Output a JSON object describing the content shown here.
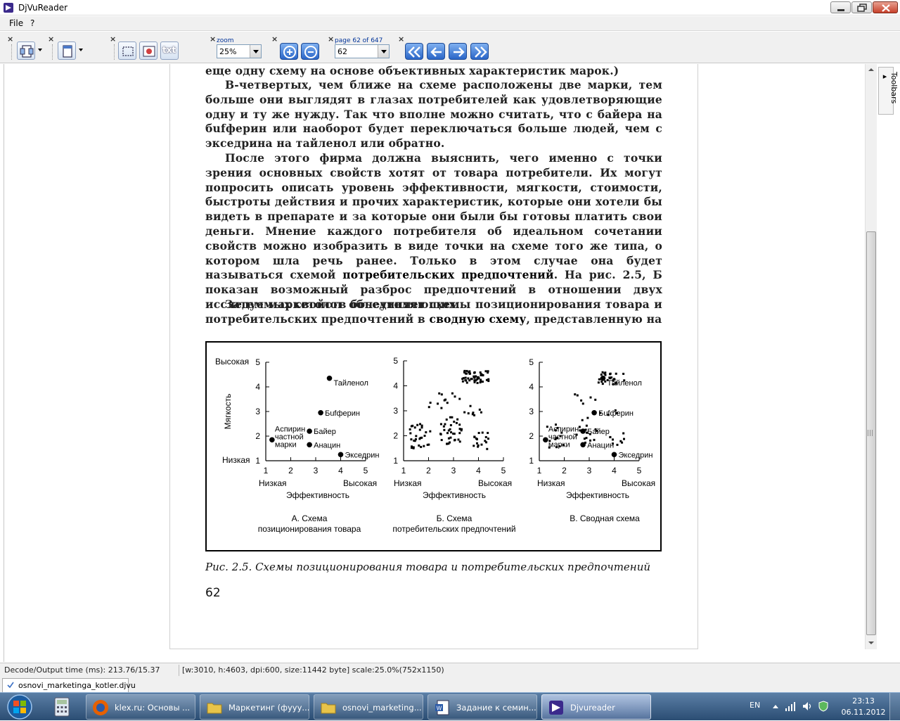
{
  "window": {
    "title": "DjVuReader"
  },
  "menu": [
    {
      "label": "File"
    },
    {
      "label": "?"
    }
  ],
  "toolbar": {
    "close_glyph": "×",
    "zoom_label": "zoom",
    "zoom_value": "25%",
    "page_label": "page 62 of 647",
    "page_value": "62",
    "text_button": "txt"
  },
  "toolbars_tab": "Toolbars ▸",
  "document": {
    "paragraphs": [
      {
        "text": "еще одну схему на основе объективных характеристик марок.)",
        "indent": false
      },
      {
        "text": "В-четвертых, чем ближе на схеме расположены две марки, тем больше они выглядят в глазах потребителей как удовлетворяющие одну и ту же нужду. Так что вполне можно считать, что с байера на бufферин или наоборот будет переключаться больше людей, чем с экседрина на тайленол или обратно.",
        "indent": true
      },
      {
        "pre": "После этого фирма должна выяснить, чего именно с точки зрения основных свойств хотят от товара потребители. Их могут попросить описать уровень эффективности, мягкости, стоимости, быстроты действия и прочих характеристик, которые они хотели бы видеть в препарате и за которые они были бы готовы платить свои деньги. Мнение каждого потребителя об идеальном сочетании свойств можно изобразить в виде точки на схеме того же типа, о котором шла речь ранее. Только в этом случае она будет называться схемой ",
        "bold": "потребительских предпочтений",
        "post": ". На рис. 2.5, Б показан возможный разброс предпочтений в отношении двух исследуемых свойств болеутоляющих."
      },
      {
        "pre": "Затем маркетолог объединяет схемы позиционирования товара и потребительских предпочтений в ",
        "bold": "сводную схему",
        "post": ", представленную на"
      }
    ],
    "figure": {
      "panel_a": {
        "y_axis": "Мягкость",
        "y_high": "Высокая",
        "y_low": "Низкая",
        "x_high": "Высокая",
        "x_low": "Низкая",
        "x_axis": "Эффективность",
        "caption_line1": "А. Схема",
        "caption_line2": "позиционирования товара"
      },
      "panel_b": {
        "x_low": "Низкая",
        "x_high": "Высокая",
        "x_axis": "Эффективность",
        "caption_line1": "Б. Схема",
        "caption_line2": "потребительских предпочтений"
      },
      "panel_c": {
        "x_low": "Низкая",
        "x_high": "Высокая",
        "x_axis": "Эффективность",
        "caption": "В. Сводная схема"
      },
      "brands": [
        {
          "name": "Тайленол",
          "x": 3.55,
          "y": 4.35
        },
        {
          "name": "Бufферин",
          "x": 3.2,
          "y": 2.95
        },
        {
          "name": "Байер",
          "x": 2.75,
          "y": 2.2
        },
        {
          "name": "Анацин",
          "x": 2.75,
          "y": 1.65
        },
        {
          "name": "Экседрин",
          "x": 4.0,
          "y": 1.25
        },
        {
          "name_lines": [
            "Аспирин",
            "частной",
            "марки"
          ],
          "x": 1.25,
          "y": 1.85
        }
      ],
      "ticks": [
        "1",
        "2",
        "3",
        "4",
        "5"
      ],
      "caption": "Рис. 2.5. Схемы позиционирования товара и потребительских предпочтений"
    },
    "page_number": "62"
  },
  "statusbar": {
    "decode_time": "Decode/Output time (ms): 213.76/15.37",
    "page_info": "[w:3010, h:4603, dpi:600, size:11442 byte] scale:25.0%(752x1150)"
  },
  "doc_tab": {
    "label": "osnovi_marketinga_kotler.djvu"
  },
  "taskbar": {
    "tasks": [
      {
        "label": "klex.ru: Основы ..."
      },
      {
        "label": "Маркетинг (фууу..."
      },
      {
        "label": "osnovi_marketing..."
      },
      {
        "label": "Задание к семин..."
      },
      {
        "label": "Djvureader"
      }
    ],
    "lang": "EN",
    "time": "23:13",
    "date": "06.11.2012"
  },
  "colors": {
    "taskbar": "#2b4d73",
    "nav_button": "#2a66c8"
  }
}
